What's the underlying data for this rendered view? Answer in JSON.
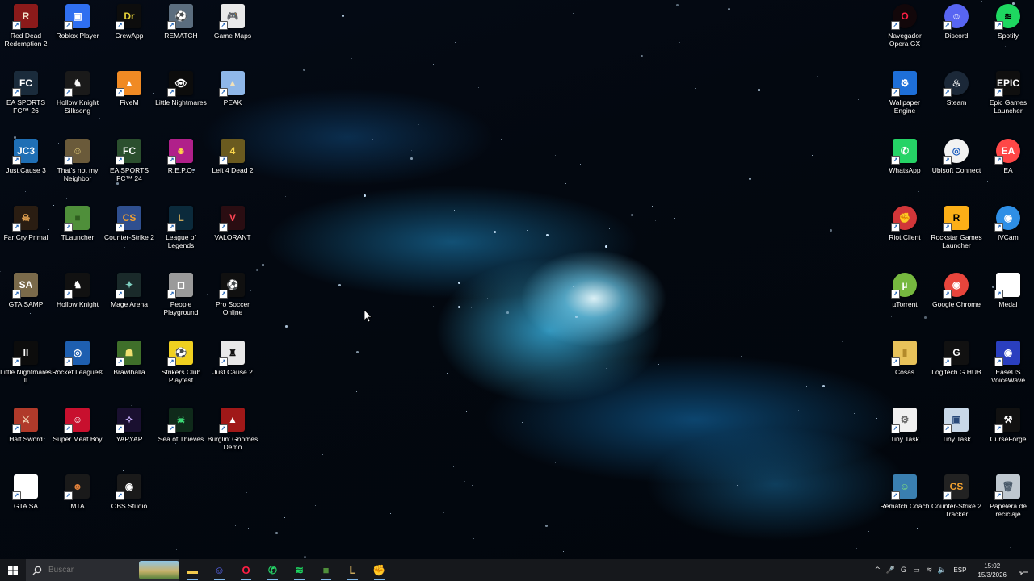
{
  "desktop": {
    "left_icons": [
      {
        "label": "Red Dead Redemption 2",
        "glyph": "R",
        "bg": "#8b1a1a",
        "fg": "#f1e6d0"
      },
      {
        "label": "Roblox Player",
        "glyph": "▣",
        "bg": "#2f6ff0",
        "fg": "#ffffff"
      },
      {
        "label": "CrewApp",
        "glyph": "Dr",
        "bg": "#0d0d0d",
        "fg": "#e8d33a"
      },
      {
        "label": "REMATCH",
        "glyph": "⚽",
        "bg": "#5b6d7e",
        "fg": "#e9e2c6"
      },
      {
        "label": "Game Maps",
        "glyph": "🎮",
        "bg": "#e9e9e9",
        "fg": "#111111"
      },
      {
        "label": "EA SPORTS FC™ 26",
        "glyph": "FC",
        "bg": "#1a2b3b",
        "fg": "#ffffff"
      },
      {
        "label": "Hollow Knight Silksong",
        "glyph": "♞",
        "bg": "#1a1a1a",
        "fg": "#f5f5f5"
      },
      {
        "label": "FiveM",
        "glyph": "▲",
        "bg": "#f08a24",
        "fg": "#ffffff"
      },
      {
        "label": "Little Nightmares",
        "glyph": "👁",
        "bg": "#0c0c0c",
        "fg": "#ffffff"
      },
      {
        "label": "PEAK",
        "glyph": "▲",
        "bg": "#8fb7e8",
        "fg": "#f2e1b8"
      },
      {
        "label": "Just Cause 3",
        "glyph": "JC3",
        "bg": "#1f6fb5",
        "fg": "#ffffff"
      },
      {
        "label": "That's not my Neighbor",
        "glyph": "☺",
        "bg": "#6a5a3a",
        "fg": "#e6cf7a"
      },
      {
        "label": "EA SPORTS FC™ 24",
        "glyph": "FC",
        "bg": "#2b4f2e",
        "fg": "#ffffff"
      },
      {
        "label": "R.E.P.O.",
        "glyph": "☻",
        "bg": "#b0208a",
        "fg": "#ffd34a"
      },
      {
        "label": "Left 4 Dead 2",
        "glyph": "4",
        "bg": "#6a5a1f",
        "fg": "#f7d34a"
      },
      {
        "label": "Far Cry Primal",
        "glyph": "☠",
        "bg": "#2a1d12",
        "fg": "#e0a050"
      },
      {
        "label": "TLauncher",
        "glyph": "■",
        "bg": "#4f8f3a",
        "fg": "#2f5f1f"
      },
      {
        "label": "Counter-Strike 2",
        "glyph": "CS",
        "bg": "#2f4f8f",
        "fg": "#f0a030"
      },
      {
        "label": "League of Legends",
        "glyph": "L",
        "bg": "#0b2a3b",
        "fg": "#c8a65a"
      },
      {
        "label": "VALORANT",
        "glyph": "V",
        "bg": "#2a0d12",
        "fg": "#ff4655"
      },
      {
        "label": "GTA SAMP",
        "glyph": "SA",
        "bg": "#7a6a4a",
        "fg": "#ffffff"
      },
      {
        "label": "Hollow Knight",
        "glyph": "♞",
        "bg": "#111111",
        "fg": "#ffffff"
      },
      {
        "label": "Mage Arena",
        "glyph": "✦",
        "bg": "#1a2a2a",
        "fg": "#7fd0c0"
      },
      {
        "label": "People Playground",
        "glyph": "◻",
        "bg": "#9a9a9a",
        "fg": "#ffffff"
      },
      {
        "label": "Pro Soccer Online",
        "glyph": "⚽",
        "bg": "#101010",
        "fg": "#ffffff"
      },
      {
        "label": "Little Nightmares II",
        "glyph": "II",
        "bg": "#0c0c0c",
        "fg": "#ffffff"
      },
      {
        "label": "Rocket League®",
        "glyph": "◎",
        "bg": "#1e5fb0",
        "fg": "#ffffff"
      },
      {
        "label": "Brawlhalla",
        "glyph": "☗",
        "bg": "#3f6f2a",
        "fg": "#f0e070"
      },
      {
        "label": "Strikers Club Playtest",
        "glyph": "⚽",
        "bg": "#f0d020",
        "fg": "#111111"
      },
      {
        "label": "Just Cause 2",
        "glyph": "♜",
        "bg": "#e8e8e8",
        "fg": "#111111"
      },
      {
        "label": "Half Sword",
        "glyph": "⚔",
        "bg": "#b03a2a",
        "fg": "#f0d0b0"
      },
      {
        "label": "Super Meat Boy",
        "glyph": "☺",
        "bg": "#c8102e",
        "fg": "#ffffff"
      },
      {
        "label": "YAPYAP",
        "glyph": "✧",
        "bg": "#1a1030",
        "fg": "#c8b0ff"
      },
      {
        "label": "Sea of Thieves",
        "glyph": "☠",
        "bg": "#0f2a1a",
        "fg": "#3ee07a"
      },
      {
        "label": "Burglin' Gnomes Demo",
        "glyph": "▲",
        "bg": "#a01818",
        "fg": "#ffffff"
      },
      {
        "label": "GTA SA",
        "glyph": "",
        "bg": "#ffffff",
        "fg": "#333333"
      },
      {
        "label": "MTA",
        "glyph": "☻",
        "bg": "#1a1a1a",
        "fg": "#e0803a"
      },
      {
        "label": "OBS Studio",
        "glyph": "◉",
        "bg": "#1a1a1a",
        "fg": "#ffffff"
      }
    ],
    "right_icons": [
      {
        "label": "Navegador Opera GX",
        "glyph": "O",
        "bg": "#12070a",
        "fg": "#ff1f44",
        "round": true
      },
      {
        "label": "Discord",
        "glyph": "☺",
        "bg": "#5865f2",
        "fg": "#ffffff",
        "round": true
      },
      {
        "label": "Spotify",
        "glyph": "≋",
        "bg": "#1ed760",
        "fg": "#000000",
        "round": true
      },
      {
        "label": "Wallpaper Engine",
        "glyph": "⚙",
        "bg": "#1e6fd8",
        "fg": "#ffffff"
      },
      {
        "label": "Steam",
        "glyph": "♨",
        "bg": "#1b2838",
        "fg": "#ffffff",
        "round": true
      },
      {
        "label": "Epic Games Launcher",
        "glyph": "EPIC",
        "bg": "#0f0f0f",
        "fg": "#ffffff"
      },
      {
        "label": "WhatsApp",
        "glyph": "✆",
        "bg": "#25d366",
        "fg": "#ffffff"
      },
      {
        "label": "Ubisoft Connect",
        "glyph": "◎",
        "bg": "#f2f2f2",
        "fg": "#2060c0",
        "round": true
      },
      {
        "label": "EA",
        "glyph": "EA",
        "bg": "#ff4747",
        "fg": "#ffffff",
        "round": true
      },
      {
        "label": "Riot Client",
        "glyph": "✊",
        "bg": "#d13639",
        "fg": "#ffffff",
        "round": true
      },
      {
        "label": "Rockstar Games Launcher",
        "glyph": "R",
        "bg": "#fcaf17",
        "fg": "#000000"
      },
      {
        "label": "iVCam",
        "glyph": "◉",
        "bg": "#2e8fe6",
        "fg": "#ffffff",
        "round": true
      },
      {
        "label": "µTorrent",
        "glyph": "µ",
        "bg": "#76b83f",
        "fg": "#ffffff",
        "round": true
      },
      {
        "label": "Google Chrome",
        "glyph": "◉",
        "bg": "#e8453c",
        "fg": "#ffffff",
        "round": true
      },
      {
        "label": "Medal",
        "glyph": "",
        "bg": "#ffffff",
        "fg": "#333333"
      },
      {
        "label": "Cosas",
        "glyph": "▮",
        "bg": "#e8c25a",
        "fg": "#b38a2a"
      },
      {
        "label": "Logitech G HUB",
        "glyph": "G",
        "bg": "#111111",
        "fg": "#ffffff"
      },
      {
        "label": "EaseUS VoiceWave",
        "glyph": "◉",
        "bg": "#2a3fbf",
        "fg": "#ffffff"
      },
      {
        "label": "Tiny Task",
        "glyph": "⚙",
        "bg": "#f0f0f0",
        "fg": "#666666"
      },
      {
        "label": "Tiny Task",
        "glyph": "▣",
        "bg": "#c8d8e8",
        "fg": "#2a4a7a"
      },
      {
        "label": "CurseForge",
        "glyph": "⚒",
        "bg": "#111111",
        "fg": "#ffffff"
      },
      {
        "label": "Rematch Coach",
        "glyph": "☺",
        "bg": "#3a7fb0",
        "fg": "#7fe07f"
      },
      {
        "label": "Counter-Strike 2 Tracker",
        "glyph": "CS",
        "bg": "#222222",
        "fg": "#f0a030"
      },
      {
        "label": "Papelera de reciclaje",
        "glyph": "🗑",
        "bg": "#bfc8d0",
        "fg": "#4a5a6a"
      }
    ]
  },
  "taskbar": {
    "search_placeholder": "Buscar",
    "apps": [
      {
        "name": "file-explorer",
        "glyph": "▬",
        "color": "#f2c94c"
      },
      {
        "name": "discord",
        "glyph": "☺",
        "color": "#5865f2"
      },
      {
        "name": "opera-gx",
        "glyph": "O",
        "color": "#ff1f44"
      },
      {
        "name": "whatsapp",
        "glyph": "✆",
        "color": "#25d366"
      },
      {
        "name": "spotify",
        "glyph": "≋",
        "color": "#1ed760"
      },
      {
        "name": "minecraft",
        "glyph": "■",
        "color": "#4f8f3a"
      },
      {
        "name": "league",
        "glyph": "L",
        "color": "#c8a65a"
      },
      {
        "name": "riot-client",
        "glyph": "✊",
        "color": "#d13639"
      }
    ],
    "language": "ESP",
    "time": "15:02",
    "date": "15/3/2026"
  }
}
